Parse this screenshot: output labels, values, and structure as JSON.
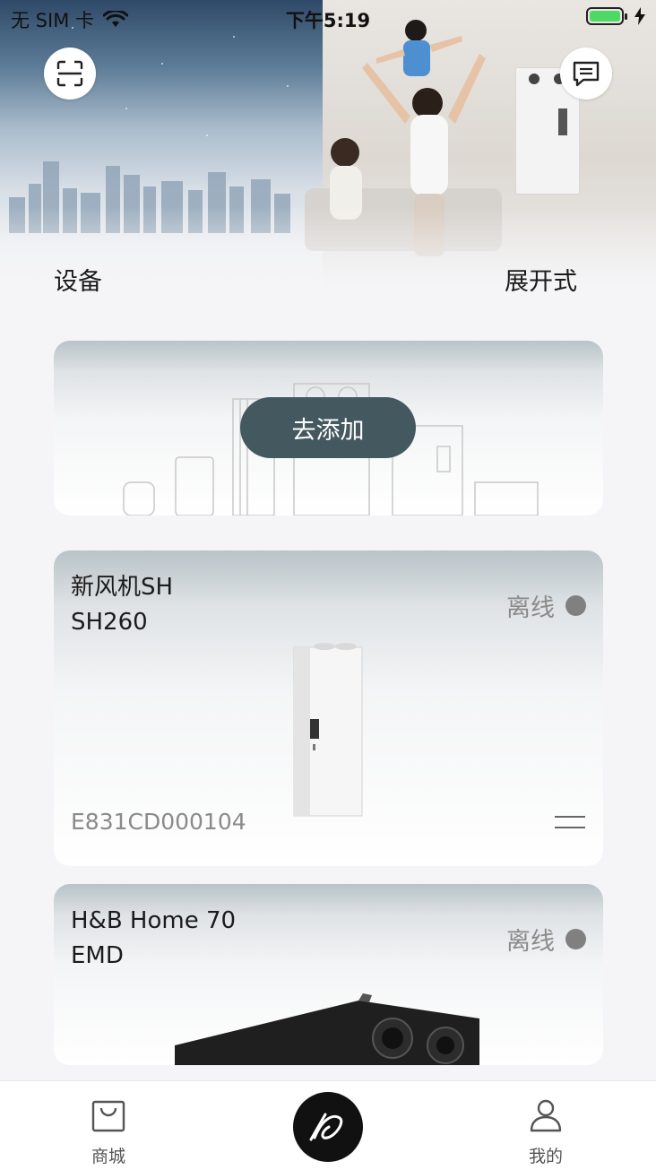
{
  "status_bar": {
    "carrier": "无 SIM 卡",
    "time": "下午5:19",
    "icons": [
      "wifi-icon",
      "battery-icon",
      "charging-icon"
    ]
  },
  "header": {
    "scan_icon": "scan-icon",
    "message_icon": "message-icon",
    "title": "设备",
    "layout_toggle": "展开式"
  },
  "add_card": {
    "button_label": "去添加"
  },
  "devices": [
    {
      "name_line1": "新风机SH",
      "name_line2": "SH260",
      "status": "离线",
      "serial": "E831CD000104",
      "menu_icon": "menu-lines-icon"
    },
    {
      "name_line1": "H&B Home 70",
      "name_line2": "EMD",
      "status": "离线"
    }
  ],
  "tabbar": {
    "shop_label": "商城",
    "center_icon": "brand-logo-icon",
    "mine_label": "我的"
  },
  "colors": {
    "accent_button": "#44585f",
    "offline_dot": "#808080",
    "battery_green": "#4cd964"
  }
}
